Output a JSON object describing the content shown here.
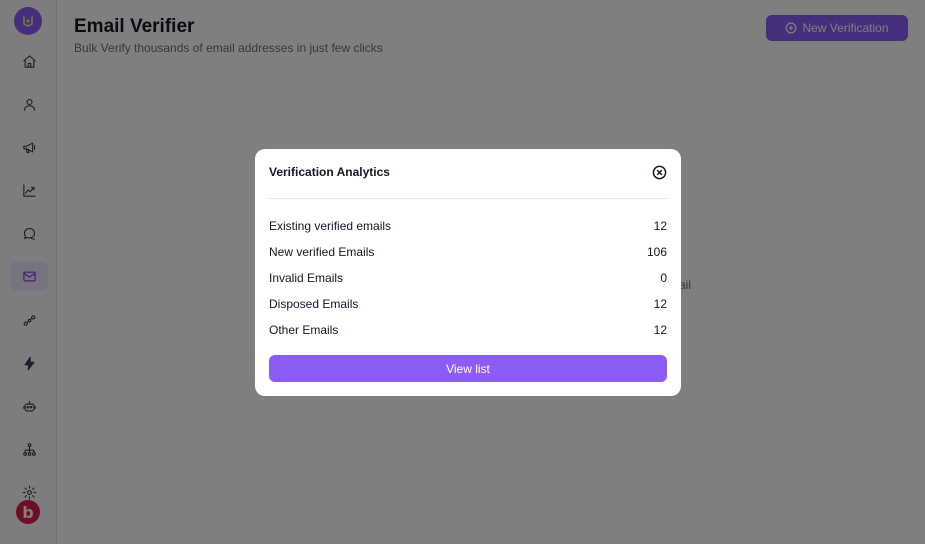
{
  "app": {
    "logo_icon": "logo-icon",
    "brand_icon": "brand-b-icon",
    "brand_letter": "b",
    "accent_color": "#8b5cf6"
  },
  "sidebar": {
    "items": [
      {
        "icon": "home-icon",
        "active": false
      },
      {
        "icon": "user-icon",
        "active": false
      },
      {
        "icon": "megaphone-icon",
        "active": false
      },
      {
        "icon": "chart-icon",
        "active": false
      },
      {
        "icon": "chat-icon",
        "active": false
      },
      {
        "icon": "mail-icon",
        "active": true
      },
      {
        "icon": "integration-icon",
        "active": false
      },
      {
        "icon": "lightning-icon",
        "active": false
      },
      {
        "icon": "bot-icon",
        "active": false
      },
      {
        "icon": "network-icon",
        "active": false
      },
      {
        "icon": "gear-icon",
        "active": false
      }
    ]
  },
  "header": {
    "title": "Email Verifier",
    "subtitle": "Bulk Verify thousands of email addresses in just few clicks",
    "new_button_label": "New Verification",
    "new_button_icon": "plus-circle-icon"
  },
  "background": {
    "fragment_text": "ail"
  },
  "modal": {
    "title": "Verification Analytics",
    "close_icon": "close-icon",
    "stats": [
      {
        "label": "Existing verified emails",
        "value": "12"
      },
      {
        "label": "New verified Emails",
        "value": "106"
      },
      {
        "label": "Invalid Emails",
        "value": "0"
      },
      {
        "label": "Disposed Emails",
        "value": "12"
      },
      {
        "label": "Other Emails",
        "value": "12"
      }
    ],
    "view_button_label": "View list"
  }
}
